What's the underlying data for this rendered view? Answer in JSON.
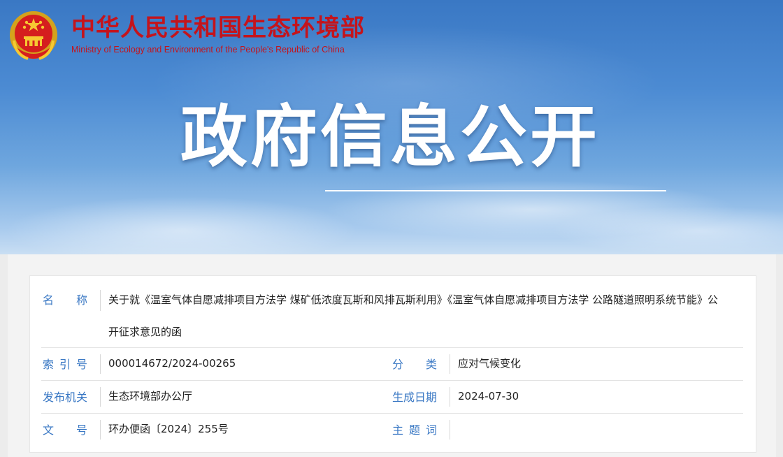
{
  "header": {
    "site_title": "中华人民共和国生态环境部",
    "site_subtitle": "Ministry of Ecology and Environment of the People's Republic of China",
    "hero_title": "政府信息公开"
  },
  "colors": {
    "brand_red": "#c4141c",
    "label_blue": "#3a78c4"
  },
  "info": {
    "name_label": "名称",
    "name_value": "关于就《温室气体自愿减排项目方法学 煤矿低浓度瓦斯和风排瓦斯利用》《温室气体自愿减排项目方法学 公路隧道照明系统节能》公开征求意见的函",
    "index_label": "索引号",
    "index_value": "000014672/2024-00265",
    "category_label": "分类",
    "category_value": "应对气候变化",
    "publisher_label": "发布机关",
    "publisher_value": "生态环境部办公厅",
    "date_label": "生成日期",
    "date_value": "2024-07-30",
    "doc_no_label": "文号",
    "doc_no_value": "环办便函〔2024〕255号",
    "topic_label": "主题词",
    "topic_value": ""
  }
}
